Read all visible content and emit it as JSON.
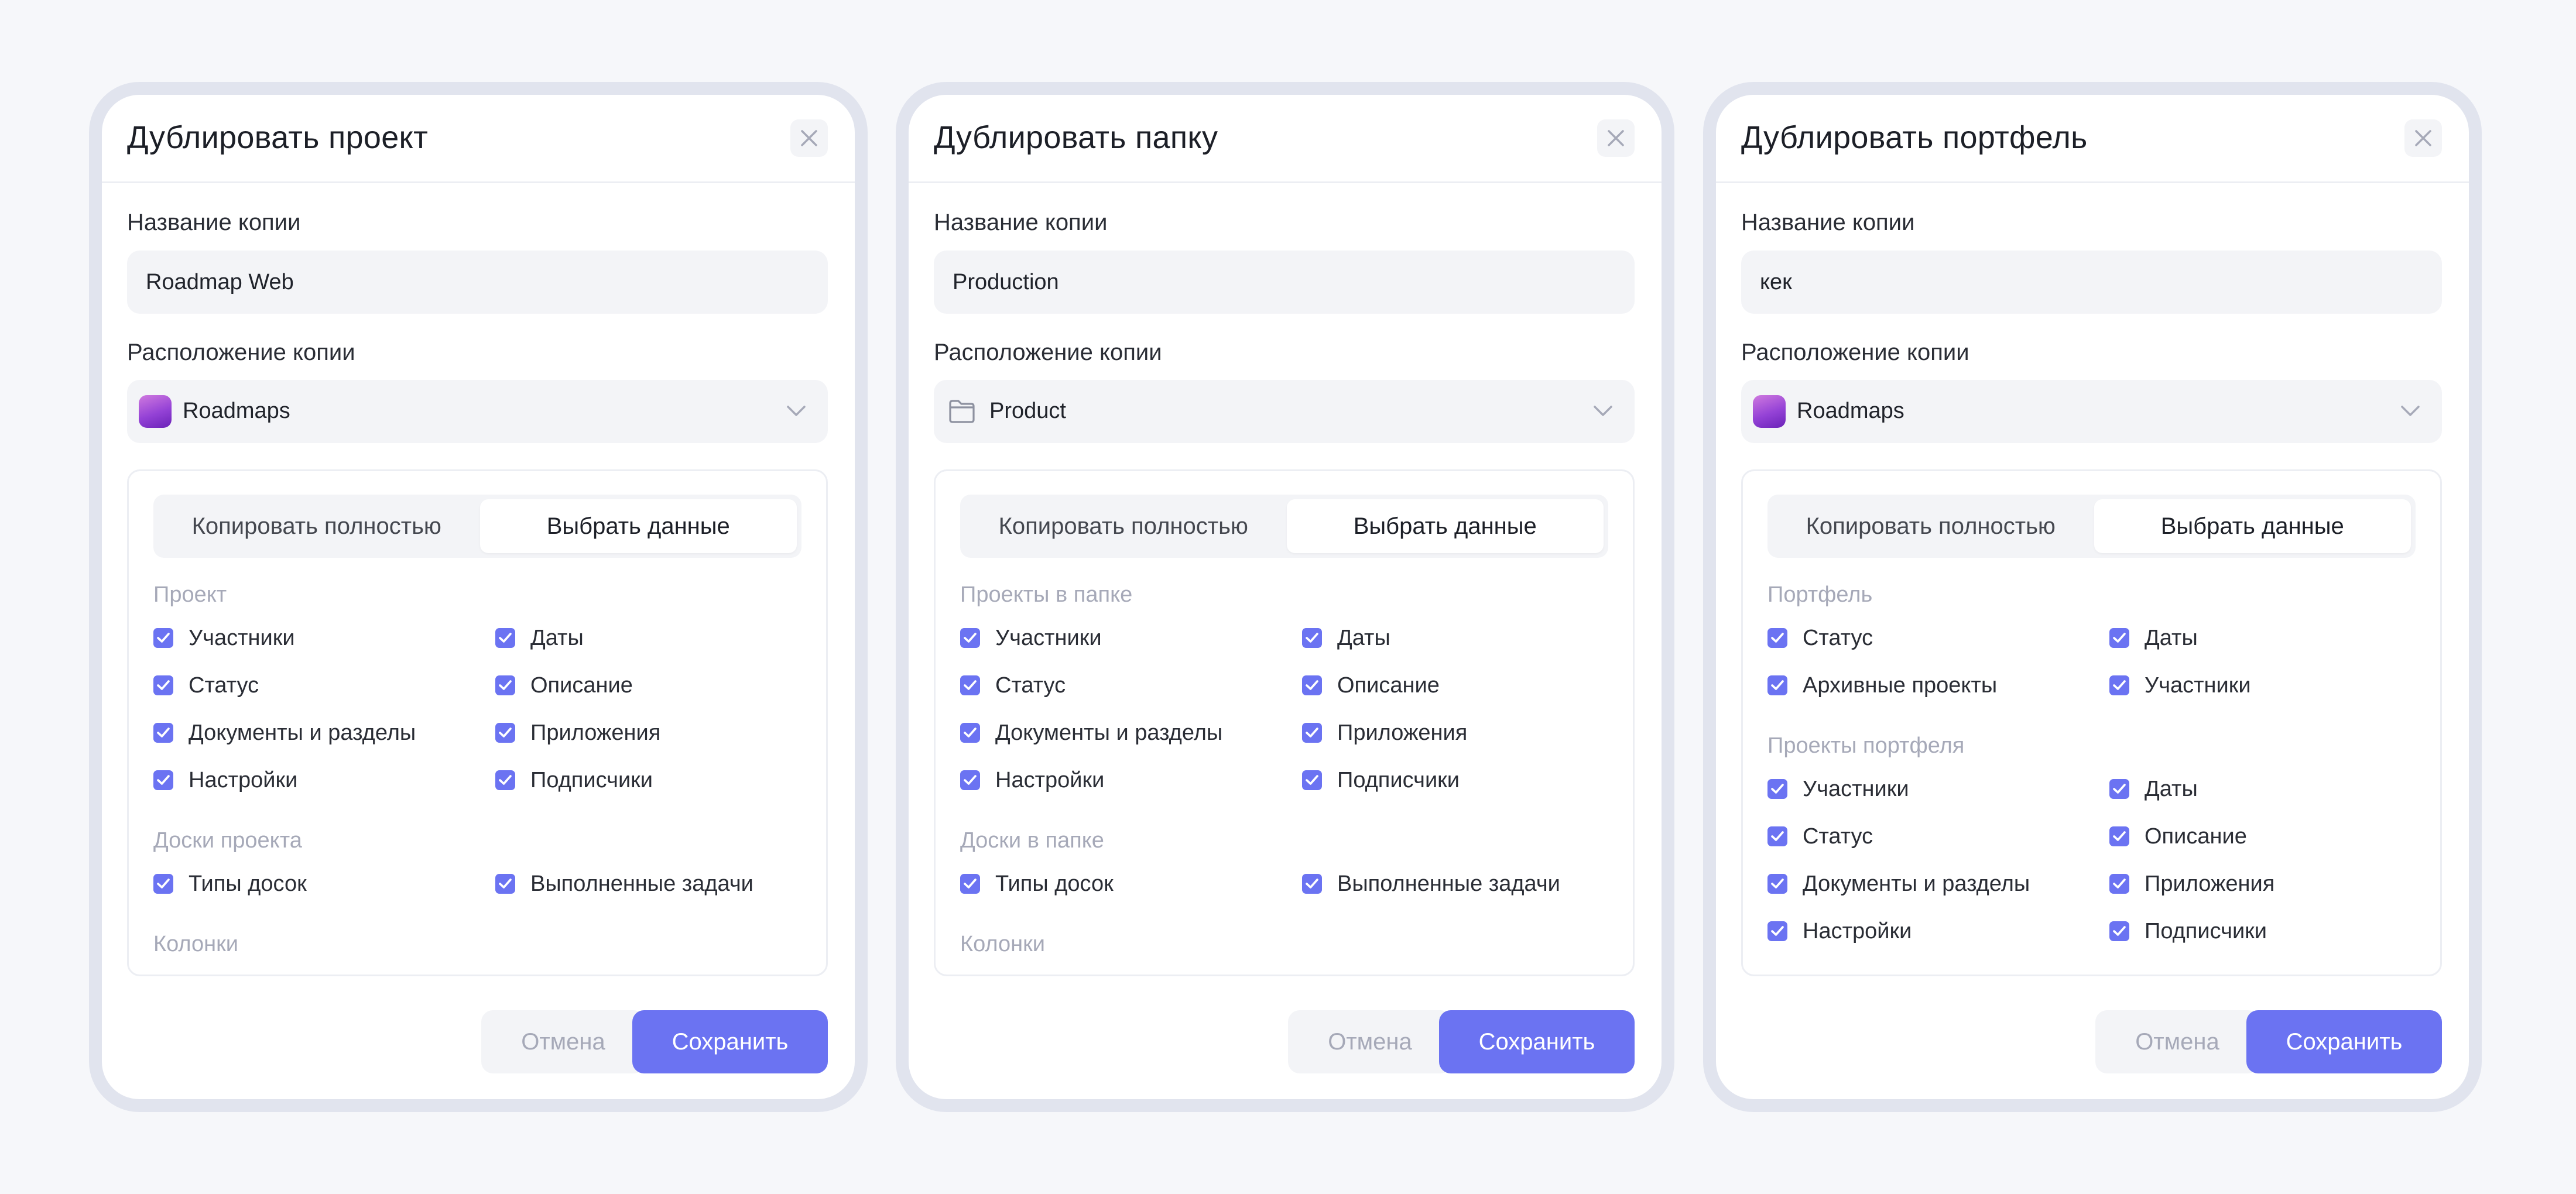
{
  "colors": {
    "accent": "#6b73f2",
    "muted": "#a6a9b8",
    "surface": "#f3f4f7",
    "border": "#e1e4ee"
  },
  "common": {
    "name_label": "Название копии",
    "location_label": "Расположение копии",
    "mode_full": "Копировать полностью",
    "mode_select": "Выбрать данные",
    "cancel": "Отмена",
    "save": "Сохранить"
  },
  "dialogs": [
    {
      "title": "Дублировать проект",
      "name_value": "Roadmap Web",
      "location_icon": "app-icon",
      "location_value": "Roadmaps",
      "sections": [
        {
          "title": "Проект",
          "items": [
            "Участники",
            "Даты",
            "Статус",
            "Описание",
            "Документы и разделы",
            "Приложения",
            "Настройки",
            "Подписчики"
          ]
        },
        {
          "title": "Доски проекта",
          "items": [
            "Типы досок",
            "Выполненные задачи"
          ]
        },
        {
          "title": "Колонки",
          "items": []
        }
      ]
    },
    {
      "title": "Дублировать папку",
      "name_value": "Production",
      "location_icon": "folder-icon",
      "location_value": "Product",
      "sections": [
        {
          "title": "Проекты в папке",
          "items": [
            "Участники",
            "Даты",
            "Статус",
            "Описание",
            "Документы и разделы",
            "Приложения",
            "Настройки",
            "Подписчики"
          ]
        },
        {
          "title": "Доски в папке",
          "items": [
            "Типы досок",
            "Выполненные задачи"
          ]
        },
        {
          "title": "Колонки",
          "items": []
        }
      ]
    },
    {
      "title": "Дублировать портфель",
      "name_value": "кек",
      "location_icon": "app-icon",
      "location_value": "Roadmaps",
      "sections": [
        {
          "title": "Портфель",
          "items": [
            "Статус",
            "Даты",
            "Архивные проекты",
            "Участники"
          ]
        },
        {
          "title": "Проекты портфеля",
          "items": [
            "Участники",
            "Даты",
            "Статус",
            "Описание",
            "Документы и разделы",
            "Приложения",
            "Настройки",
            "Подписчики"
          ]
        }
      ]
    }
  ]
}
